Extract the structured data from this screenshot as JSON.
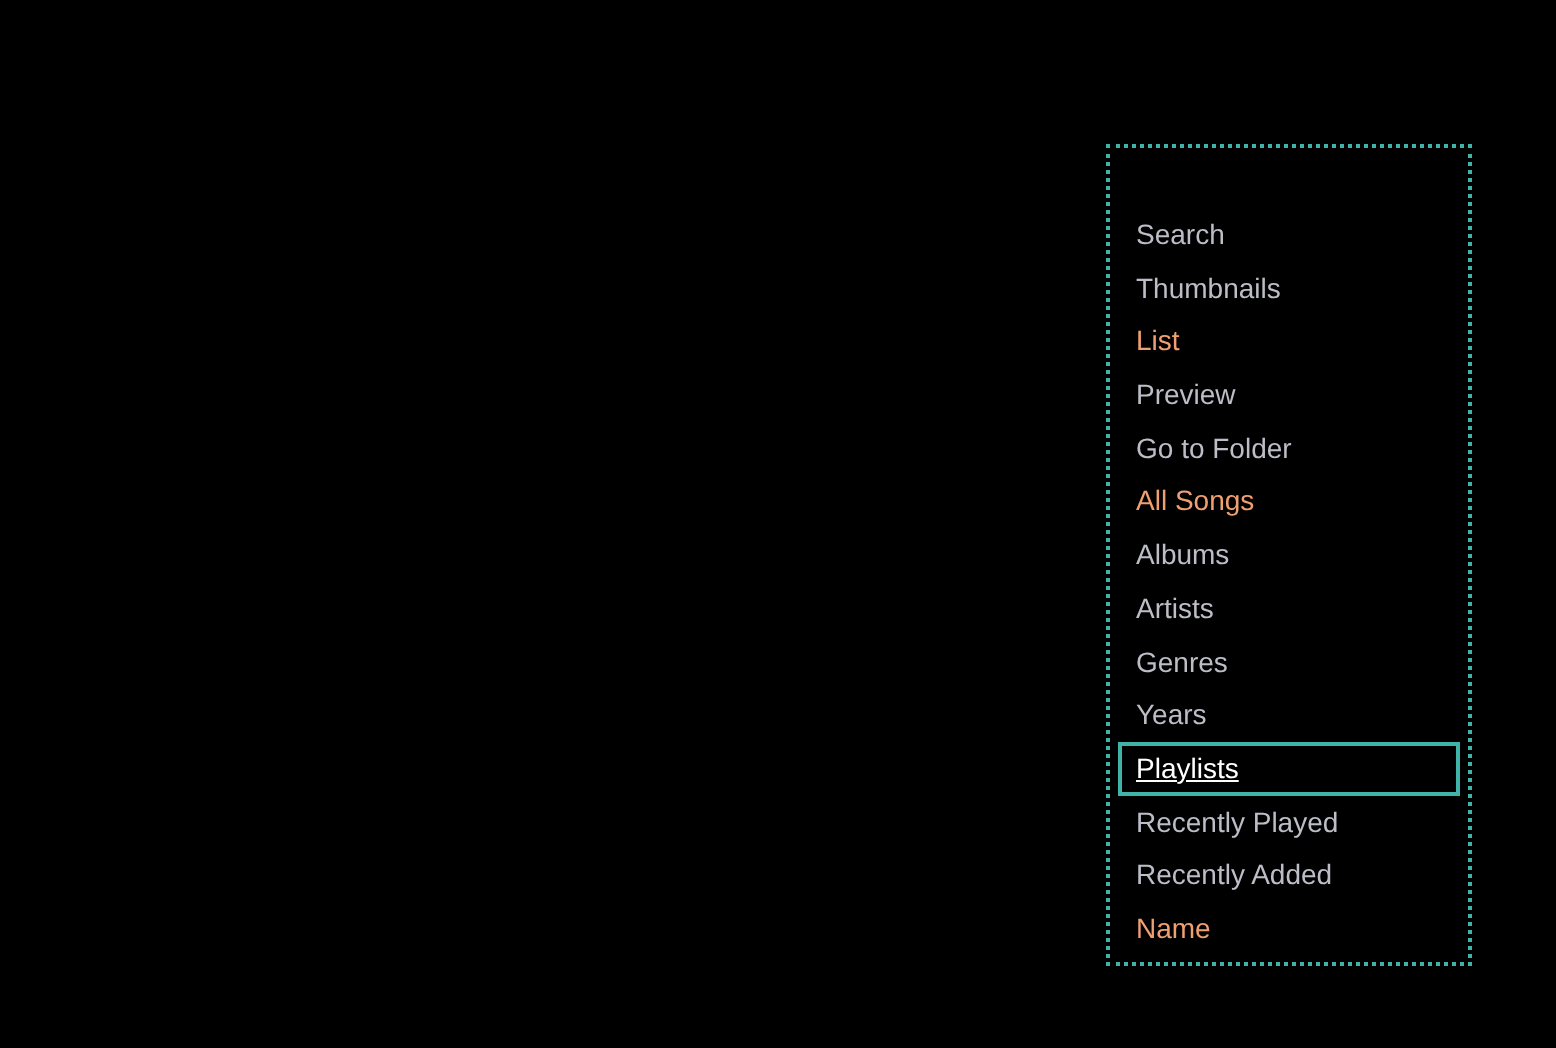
{
  "menu": {
    "items": [
      {
        "label": "Search",
        "active": false,
        "selected": false
      },
      {
        "label": "Thumbnails",
        "active": false,
        "selected": false
      },
      {
        "label": "List",
        "active": true,
        "selected": false
      },
      {
        "label": "Preview",
        "active": false,
        "selected": false
      },
      {
        "label": "Go to Folder",
        "active": false,
        "selected": false
      },
      {
        "label": "All Songs",
        "active": true,
        "selected": false
      },
      {
        "label": "Albums",
        "active": false,
        "selected": false
      },
      {
        "label": "Artists",
        "active": false,
        "selected": false
      },
      {
        "label": "Genres",
        "active": false,
        "selected": false
      },
      {
        "label": "Years",
        "active": false,
        "selected": false
      },
      {
        "label": "Playlists",
        "active": false,
        "selected": true
      },
      {
        "label": "Recently Played",
        "active": false,
        "selected": false
      },
      {
        "label": "Recently Added",
        "active": false,
        "selected": false
      },
      {
        "label": "Name",
        "active": true,
        "selected": false
      }
    ]
  }
}
